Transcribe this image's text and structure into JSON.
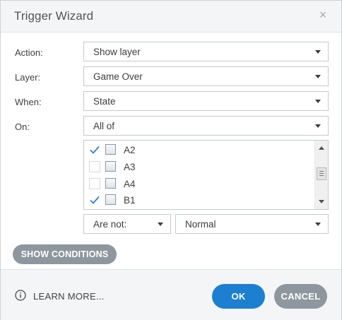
{
  "dialog": {
    "title": "Trigger Wizard",
    "close_glyph": "×"
  },
  "fields": {
    "action": {
      "label": "Action:",
      "value": "Show layer"
    },
    "layer": {
      "label": "Layer:",
      "value": "Game Over"
    },
    "when": {
      "label": "When:",
      "value": "State"
    },
    "on": {
      "label": "On:",
      "value": "All of"
    }
  },
  "objects_list": {
    "items": [
      {
        "label": "A2",
        "checked": true
      },
      {
        "label": "A3",
        "checked": false
      },
      {
        "label": "A4",
        "checked": false
      },
      {
        "label": "B1",
        "checked": true
      }
    ]
  },
  "condition": {
    "operator": "Are not:",
    "state": "Normal"
  },
  "buttons": {
    "show_conditions": "SHOW CONDITIONS",
    "learn_more": "LEARN MORE...",
    "ok": "OK",
    "cancel": "CANCEL"
  },
  "colors": {
    "accent": "#1d7fd0",
    "secondary_button": "#8f979e",
    "checkmark": "#2a7fd4"
  },
  "icons": {
    "close": "close-icon",
    "info": "info-icon",
    "checkmark": "checkmark-icon",
    "caret": "chevron-down-icon"
  }
}
